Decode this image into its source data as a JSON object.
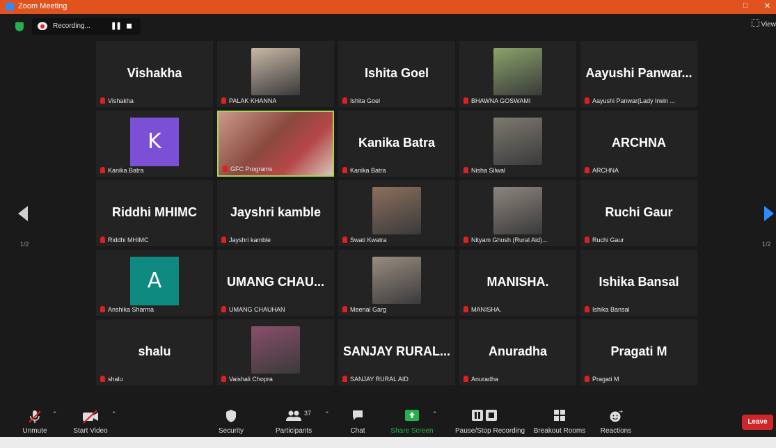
{
  "window": {
    "title": "Zoom Meeting"
  },
  "topbar": {
    "recording_label": "Recording...",
    "view_label": "View"
  },
  "pagination": {
    "left": "1/2",
    "right": "1/2"
  },
  "participants": [
    {
      "display": "Vishakha",
      "label": "Vishakha",
      "type": "name"
    },
    {
      "display": "",
      "label": "PALAK KHANNA",
      "type": "photo",
      "color": "#c9b8a6"
    },
    {
      "display": "Ishita Goel",
      "label": "Ishita Goel",
      "type": "name"
    },
    {
      "display": "",
      "label": "BHAWNA GOSWAMI",
      "type": "photo",
      "color": "#8aa36a"
    },
    {
      "display": "Aayushi  Panwar...",
      "label": "Aayushi Panwar(Lady Irwin ...",
      "type": "name"
    },
    {
      "display": "K",
      "label": "Kanika Batra",
      "type": "avatar",
      "color": "#7b4fd6"
    },
    {
      "display": "",
      "label": "GFC Programs",
      "type": "video",
      "color": "#c99a8a"
    },
    {
      "display": "Kanika Batra",
      "label": "Kanika Batra",
      "type": "name"
    },
    {
      "display": "",
      "label": "Nisha Silwal",
      "type": "photo",
      "color": "#7e7a70"
    },
    {
      "display": "ARCHNA",
      "label": "ARCHNA",
      "type": "name"
    },
    {
      "display": "Riddhi MHIMC",
      "label": "Riddhi MHIMC",
      "type": "name"
    },
    {
      "display": "Jayshri kamble",
      "label": "Jayshri kamble",
      "type": "name"
    },
    {
      "display": "",
      "label": "Swati Kwatra",
      "type": "photo",
      "color": "#8b6f5c"
    },
    {
      "display": "",
      "label": "Nityam Ghosh (Rural Aid)...",
      "type": "photo",
      "color": "#8c857e"
    },
    {
      "display": "Ruchi Gaur",
      "label": "Ruchi Gaur",
      "type": "name"
    },
    {
      "display": "A",
      "label": "Anshika Sharma",
      "type": "avatar",
      "color": "#0e8a80"
    },
    {
      "display": "UMANG  CHAU...",
      "label": "UMANG CHAUHAN",
      "type": "name"
    },
    {
      "display": "",
      "label": "Meenal Garg",
      "type": "photo",
      "color": "#9a8d80"
    },
    {
      "display": "MANISHA.",
      "label": "MANISHA.",
      "type": "name"
    },
    {
      "display": "Ishika Bansal",
      "label": "Ishika Bansal",
      "type": "name"
    },
    {
      "display": "shalu",
      "label": "shalu",
      "type": "name"
    },
    {
      "display": "",
      "label": "Vaishali Chopra",
      "type": "photo",
      "color": "#8a4f6a"
    },
    {
      "display": "SANJAY  RURAL...",
      "label": "SANJAY RURAL AID",
      "type": "name"
    },
    {
      "display": "Anuradha",
      "label": "Anuradha",
      "type": "name"
    },
    {
      "display": "Pragati M",
      "label": "Pragati M",
      "type": "name"
    }
  ],
  "toolbar": {
    "unmute": "Unmute",
    "start_video": "Start Video",
    "security": "Security",
    "participants": "Participants",
    "participant_count": "37",
    "chat": "Chat",
    "share_screen": "Share Screen",
    "recording": "Pause/Stop Recording",
    "breakout": "Breakout Rooms",
    "reactions": "Reactions",
    "leave": "Leave"
  },
  "colors": {
    "accent": "#2d8cff",
    "share_green": "#23b04d",
    "leave_red": "#d0262a",
    "active_border": "#a7d55a"
  }
}
